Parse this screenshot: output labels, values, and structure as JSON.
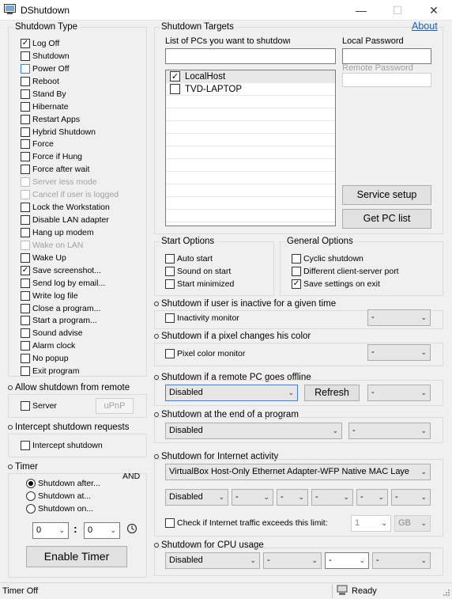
{
  "window": {
    "title": "DShutdown"
  },
  "about_link": "About",
  "shutdown_type": {
    "legend": "Shutdown Type",
    "items": [
      {
        "label": "Log Off",
        "checked": true,
        "disabled": false
      },
      {
        "label": "Shutdown",
        "checked": false,
        "disabled": false
      },
      {
        "label": "Power Off",
        "checked": false,
        "disabled": false
      },
      {
        "label": "Reboot",
        "checked": false,
        "disabled": false
      },
      {
        "label": "Stand By",
        "checked": false,
        "disabled": false
      },
      {
        "label": "Hibernate",
        "checked": false,
        "disabled": false
      },
      {
        "label": "Restart Apps",
        "checked": false,
        "disabled": false
      },
      {
        "label": "Hybrid Shutdown",
        "checked": false,
        "disabled": false
      },
      {
        "label": "Force",
        "checked": false,
        "disabled": false
      },
      {
        "label": "Force if Hung",
        "checked": false,
        "disabled": false
      },
      {
        "label": "Force after wait",
        "checked": false,
        "disabled": false
      },
      {
        "label": "Server less mode",
        "checked": false,
        "disabled": true
      },
      {
        "label": "Cancel if user is logged",
        "checked": false,
        "disabled": true
      },
      {
        "label": "Lock the Workstation",
        "checked": false,
        "disabled": false
      },
      {
        "label": "Disable LAN adapter",
        "checked": false,
        "disabled": false
      },
      {
        "label": "Hang up modem",
        "checked": false,
        "disabled": false
      },
      {
        "label": "Wake on LAN",
        "checked": false,
        "disabled": true
      },
      {
        "label": "Wake Up",
        "checked": false,
        "disabled": false
      },
      {
        "label": "Save screenshot...",
        "checked": true,
        "disabled": false
      },
      {
        "label": "Send log by email...",
        "checked": false,
        "disabled": false
      },
      {
        "label": "Write log file",
        "checked": false,
        "disabled": false
      },
      {
        "label": "Close a program...",
        "checked": false,
        "disabled": false
      },
      {
        "label": "Start a program...",
        "checked": false,
        "disabled": false
      },
      {
        "label": "Sound advise",
        "checked": false,
        "disabled": false
      },
      {
        "label": "Alarm clock",
        "checked": false,
        "disabled": false
      },
      {
        "label": "No popup",
        "checked": false,
        "disabled": false
      },
      {
        "label": "Exit program",
        "checked": false,
        "disabled": false
      }
    ]
  },
  "allow_remote": {
    "title": "Allow shutdown from remote",
    "server_label": "Server",
    "upnp_label": "uPnP"
  },
  "intercept": {
    "title": "Intercept shutdown requests",
    "checkbox_label": "Intercept shutdown"
  },
  "timer": {
    "title": "Timer",
    "and_label": "AND",
    "radios": [
      {
        "label": "Shutdown after...",
        "selected": true
      },
      {
        "label": "Shutdown at...",
        "selected": false
      },
      {
        "label": "Shutdown on...",
        "selected": false
      }
    ],
    "hours": "0",
    "separator": ":",
    "minutes": "0",
    "enable_button": "Enable Timer"
  },
  "targets": {
    "legend": "Shutdown Targets",
    "list_label": "List of PCs you want to shutdowr",
    "local_password_label": "Local Password",
    "remote_password_label": "Remote Password",
    "pcs": [
      {
        "name": "LocalHost",
        "checked": true
      },
      {
        "name": "TVD-LAPTOP",
        "checked": false
      }
    ],
    "service_setup_button": "Service setup",
    "get_pc_list_button": "Get PC list"
  },
  "start_options": {
    "legend": "Start Options",
    "items": [
      {
        "label": "Auto start",
        "checked": false
      },
      {
        "label": "Sound on start",
        "checked": false
      },
      {
        "label": "Start minimized",
        "checked": false
      }
    ]
  },
  "general_options": {
    "legend": "General Options",
    "items": [
      {
        "label": "Cyclic shutdown",
        "checked": false
      },
      {
        "label": "Different client-server port",
        "checked": false
      },
      {
        "label": "Save settings on exit",
        "checked": true
      }
    ]
  },
  "inactive": {
    "title": "Shutdown if user is inactive for a given time",
    "checkbox_label": "Inactivity monitor",
    "select_value": "-"
  },
  "pixel": {
    "title": "Shutdown if a pixel changes his color",
    "checkbox_label": "Pixel color monitor",
    "select_value": "-"
  },
  "remote_offline": {
    "title": "Shutdown if a remote PC goes offline",
    "select_value": "Disabled",
    "refresh_button": "Refresh",
    "select2_value": "-"
  },
  "end_program": {
    "title": "Shutdown at the end of a program",
    "select_value": "Disabled",
    "select2_value": "-"
  },
  "internet": {
    "title": "Shutdown for Internet activity",
    "adapter": "VirtualBox Host-Only Ethernet Adapter-WFP Native MAC Laye",
    "mode": "Disabled",
    "selects": [
      "-",
      "-",
      "-",
      "-",
      "-"
    ],
    "check_label": "Check if Internet traffic exceeds this limit:",
    "limit_value": "1",
    "unit_value": "GB"
  },
  "cpu": {
    "title": "Shutdown for CPU usage",
    "mode": "Disabled",
    "selects": [
      "-",
      "-",
      "-"
    ]
  },
  "status": {
    "left": "Timer Off",
    "right": "Ready"
  }
}
